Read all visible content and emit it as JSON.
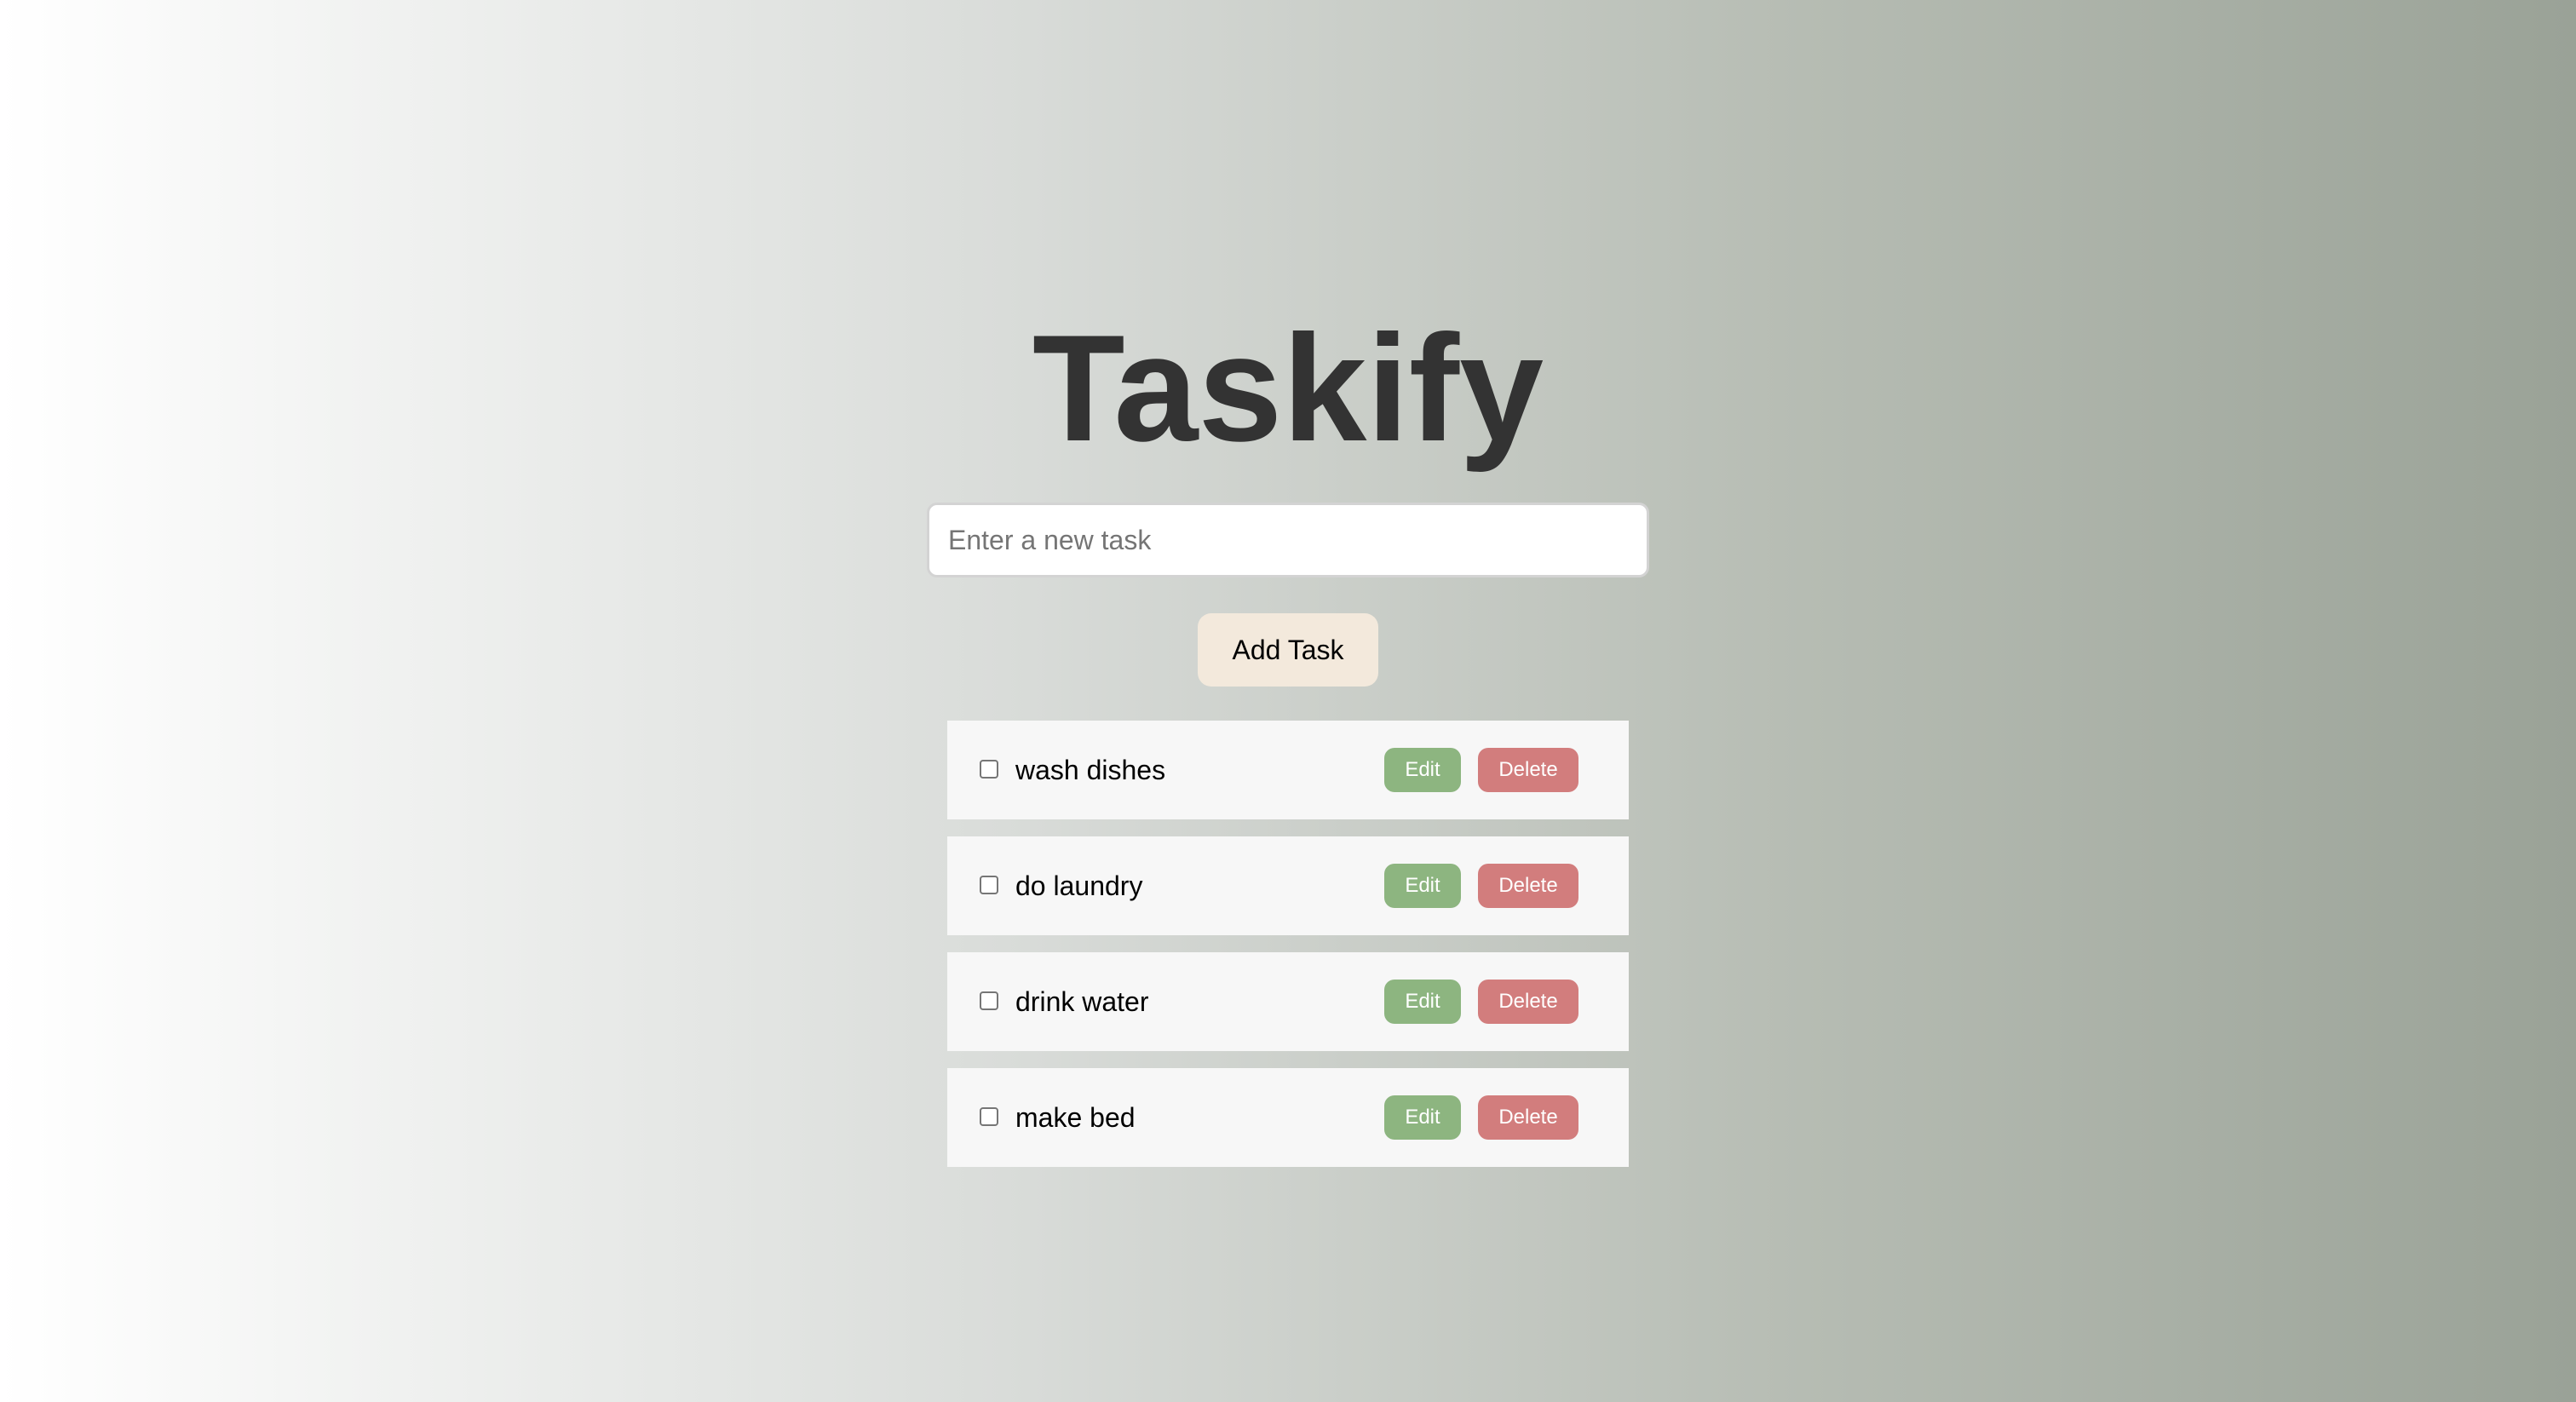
{
  "app": {
    "title": "Taskify"
  },
  "new_task": {
    "placeholder": "Enter a new task",
    "value": ""
  },
  "add_button": {
    "label": "Add Task"
  },
  "tasks": [
    {
      "label": "wash dishes",
      "checked": false,
      "edit_label": "Edit",
      "delete_label": "Delete"
    },
    {
      "label": "do laundry",
      "checked": false,
      "edit_label": "Edit",
      "delete_label": "Delete"
    },
    {
      "label": "drink water",
      "checked": false,
      "edit_label": "Edit",
      "delete_label": "Delete"
    },
    {
      "label": "make bed",
      "checked": false,
      "edit_label": "Edit",
      "delete_label": "Delete"
    }
  ],
  "colors": {
    "title_text": "#333333",
    "add_button_bg": "#f3e9dc",
    "edit_button_bg": "#8db580",
    "delete_button_bg": "#d27d7d",
    "task_item_bg": "#f7f7f7"
  }
}
